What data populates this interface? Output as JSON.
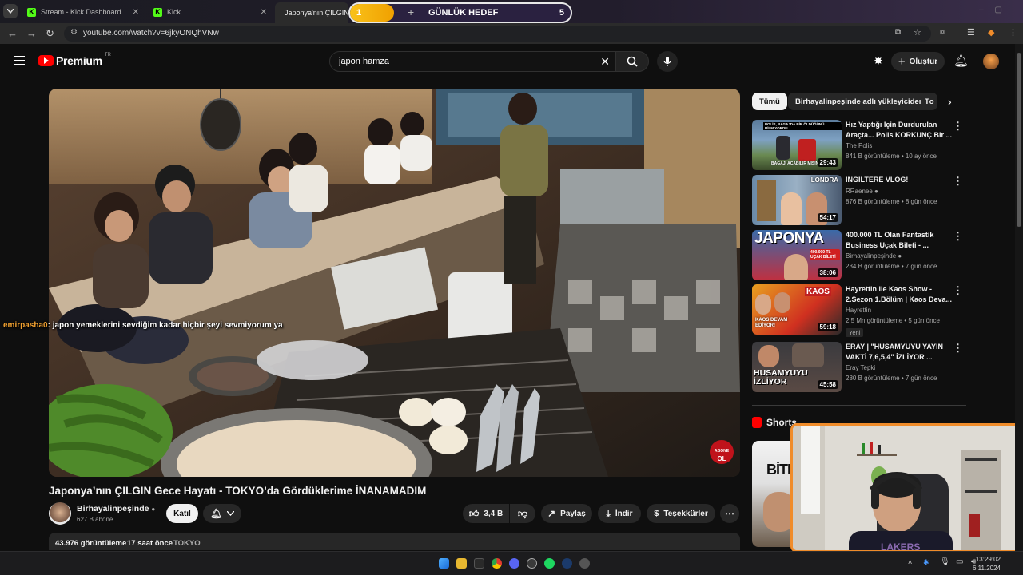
{
  "browser": {
    "tabs": [
      {
        "title": "Stream - Kick Dashboard",
        "favicon": "kick-icon",
        "active": false
      },
      {
        "title": "Kick",
        "favicon": "kick-icon",
        "active": false
      },
      {
        "title": "Japonya'nın ÇILGIN",
        "favicon": "youtube-icon",
        "active": true
      }
    ],
    "url": "youtube.com/watch?v=6jkyONQhVNw"
  },
  "goal_widget": {
    "current": "1",
    "label": "GÜNLÜK HEDEF",
    "target": "5",
    "progress": 0.2
  },
  "youtube": {
    "logo_text": "Premium",
    "region": "TR",
    "search_value": "japon hamza",
    "create_label": "Oluştur"
  },
  "video": {
    "title": "Japonya’nın ÇILGIN Gece Hayatı - TOKYO’da Gördüklerime İNANAMADIM",
    "chat_user": "emirpasha0",
    "chat_text": ": japon yemeklerini sevdiğim kadar hiçbir şeyi sevmiyorum ya",
    "overlay_badge_1": "ABONE",
    "overlay_badge_2": "OL",
    "channel": "Birhayalinpeşinde",
    "subscribers": "627 B abone",
    "join_label": "Katıl",
    "likes": "3,4 B",
    "share_label": "Paylaş",
    "download_label": "İndir",
    "thanks_label": "Teşekkürler",
    "views": "43.976 görüntüleme",
    "age": "17 saat önce",
    "tag": "TOKYO"
  },
  "sidebar": {
    "chips": [
      "Tümü",
      "Birhayalinpeşinde adlı yükleyiciden",
      "Tο"
    ],
    "recommendations": [
      {
        "title": "Hız Yaptığı İçin Durdurulan Araçta... Polis KORKUNÇ Bir ...",
        "channel": "The Polis",
        "meta": "841 B görüntüleme • 10 ay önce",
        "duration": "29:43",
        "thumb_top": "POLİS, BAGAJDA BİR ÖLDÜĞÜNÜ BİLMİYORDU",
        "thumb_bottom": "BAGAJI AÇABİLİR MİSİN",
        "verified": false,
        "badge": ""
      },
      {
        "title": "İNGİLTERE VLOG!",
        "channel": "RRaenee",
        "meta": "876 B görüntüleme • 8 gün önce",
        "duration": "54:17",
        "thumb_top": "LONDRA",
        "thumb_bottom": "",
        "verified": true,
        "badge": ""
      },
      {
        "title": "400.000 TL Olan Fantastik Business Uçak Bileti - ...",
        "channel": "Birhayalinpeşinde",
        "meta": "234 B görüntüleme • 7 gün önce",
        "duration": "38:06",
        "thumb_top": "JAPONYA",
        "thumb_bottom": "400.000 TL UÇAK BİLETİ",
        "verified": true,
        "badge": ""
      },
      {
        "title": "Hayrettin ile Kaos Show - 2.Sezon 1.Bölüm | Kaos Deva...",
        "channel": "Hayrettin",
        "meta": "2,5 Mn görüntüleme • 5 gün önce",
        "duration": "59:18",
        "thumb_top": "KAOS",
        "thumb_bottom": "KAOS DEVAM EDİYOR!",
        "verified": false,
        "badge": "Yeni"
      },
      {
        "title": "ERAY | \"HUSAMYUYU YAYIN VAKTİ 7,6,5,4\" İZLİYOR ...",
        "channel": "Eray Tepki",
        "meta": "280 B görüntüleme • 7 gün önce",
        "duration": "45:58",
        "thumb_top": "",
        "thumb_bottom": "HUSAMYUYU İZLİYOR",
        "verified": false,
        "badge": ""
      }
    ],
    "shorts_label": "Shorts",
    "short_thumb_text": "BİTM"
  },
  "taskbar": {
    "time": "13:29:02",
    "date": "6.11.2024"
  },
  "colors": {
    "youtube_red": "#ff0000",
    "goal_yellow": "#f9c21a",
    "webcam_border": "#f08c2a",
    "kick_green": "#53fc18"
  }
}
